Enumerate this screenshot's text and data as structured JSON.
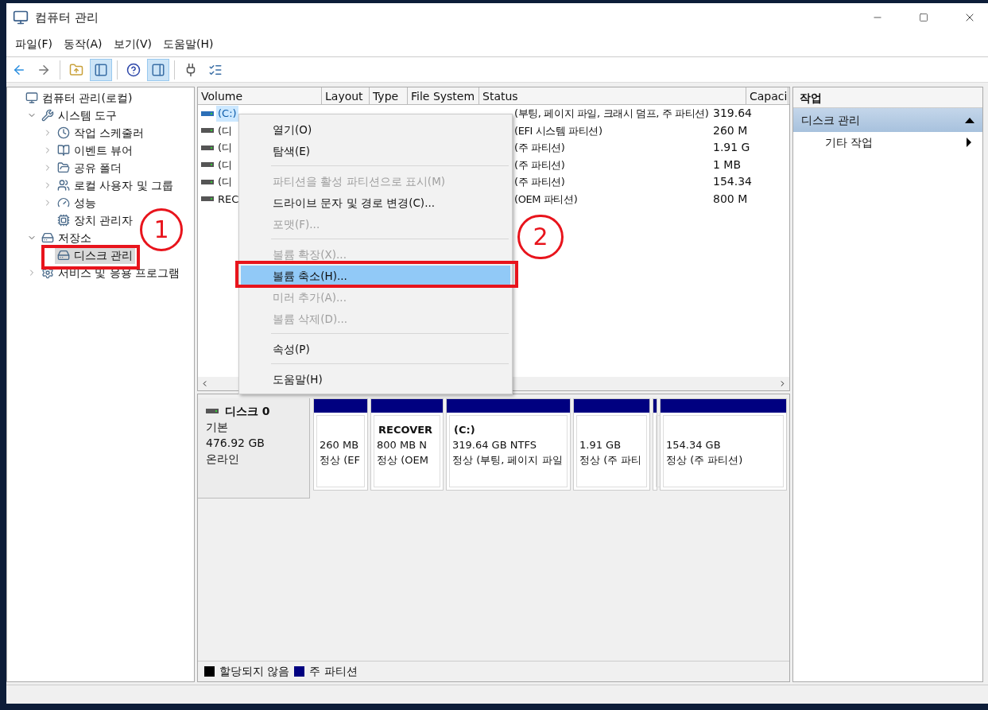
{
  "window": {
    "title": "컴퓨터 관리"
  },
  "menu_bar": [
    "파일(F)",
    "동작(A)",
    "보기(V)",
    "도움말(H)"
  ],
  "toolbar": [
    {
      "kind": "back",
      "pressed": false
    },
    {
      "kind": "forward",
      "pressed": false
    },
    {
      "kind": "up",
      "pressed": false
    },
    {
      "kind": "tree-pane",
      "pressed": true
    },
    {
      "kind": "help",
      "pressed": false
    },
    {
      "kind": "action-pane",
      "pressed": true
    },
    {
      "kind": "connect",
      "pressed": false
    },
    {
      "kind": "properties",
      "pressed": false
    }
  ],
  "tree": [
    {
      "label": "컴퓨터 관리(로컬)",
      "kind": "computer",
      "selected": false,
      "children": [
        {
          "label": "시스템 도구",
          "kind": "tools",
          "expanded": true,
          "selected": false,
          "children": [
            {
              "label": "작업 스케줄러",
              "kind": "clock",
              "expanded": false,
              "selected": false
            },
            {
              "label": "이벤트 뷰어",
              "kind": "log",
              "expanded": false,
              "selected": false
            },
            {
              "label": "공유 폴더",
              "kind": "share",
              "expanded": false,
              "selected": false
            },
            {
              "label": "로컬 사용자 및 그룹",
              "kind": "users",
              "expanded": false,
              "selected": false
            },
            {
              "label": "성능",
              "kind": "gauge",
              "expanded": false,
              "selected": false
            },
            {
              "label": "장치 관리자",
              "kind": "device",
              "selected": false
            }
          ]
        },
        {
          "label": "저장소",
          "kind": "storage",
          "expanded": true,
          "selected": false,
          "children": [
            {
              "label": "디스크 관리",
              "kind": "disk",
              "selected": true
            }
          ]
        },
        {
          "label": "서비스 및 응용 프로그램",
          "kind": "services",
          "expanded": false,
          "selected": false
        }
      ]
    }
  ],
  "volume_table": {
    "columns": [
      "Volume",
      "Layout",
      "Type",
      "File System",
      "Status",
      "Capaci"
    ],
    "rows": [
      {
        "volume": "(C:)",
        "status": "(부팅, 페이지 파일, 크래시 덤프, 주 파티션)",
        "capacity": "319.64",
        "selected": true
      },
      {
        "volume": "(디",
        "status": "(EFI 시스템 파티션)",
        "capacity": "260 M",
        "selected": false
      },
      {
        "volume": "(디",
        "status": "(주 파티션)",
        "capacity": "1.91 G",
        "selected": false
      },
      {
        "volume": "(디",
        "status": "(주 파티션)",
        "capacity": "1 MB",
        "selected": false
      },
      {
        "volume": "(디",
        "status": "(주 파티션)",
        "capacity": "154.34",
        "selected": false
      },
      {
        "volume": "REC",
        "status": "(OEM 파티션)",
        "capacity": "800 M",
        "selected": false
      }
    ]
  },
  "context_menu": [
    {
      "kind": "item",
      "label": "열기(O)",
      "disabled": false,
      "selected": false
    },
    {
      "kind": "item",
      "label": "탐색(E)",
      "disabled": false,
      "selected": false
    },
    {
      "kind": "separator"
    },
    {
      "kind": "item",
      "label": "파티션을 활성 파티션으로 표시(M)",
      "disabled": true,
      "selected": false
    },
    {
      "kind": "item",
      "label": "드라이브 문자 및 경로 변경(C)...",
      "disabled": false,
      "selected": false
    },
    {
      "kind": "item",
      "label": "포맷(F)...",
      "disabled": true,
      "selected": false
    },
    {
      "kind": "separator"
    },
    {
      "kind": "item",
      "label": "볼륨 확장(X)...",
      "disabled": true,
      "selected": false
    },
    {
      "kind": "item",
      "label": "볼륨 축소(H)...",
      "disabled": false,
      "selected": true
    },
    {
      "kind": "item",
      "label": "미러 추가(A)...",
      "disabled": true,
      "selected": false
    },
    {
      "kind": "item",
      "label": "볼륨 삭제(D)...",
      "disabled": true,
      "selected": false
    },
    {
      "kind": "separator"
    },
    {
      "kind": "item",
      "label": "속성(P)",
      "disabled": false,
      "selected": false
    },
    {
      "kind": "separator"
    },
    {
      "kind": "item",
      "label": "도움말(H)",
      "disabled": false,
      "selected": false
    }
  ],
  "disk": {
    "name": "디스크 0",
    "type": "기본",
    "size": "476.92 GB",
    "state": "온라인",
    "partitions": [
      {
        "kind": "partition",
        "size": "260 MB",
        "status": "정상 (EF"
      },
      {
        "kind": "partition",
        "name": "RECOVER",
        "size": "800 MB N",
        "status": "정상 (OEM"
      },
      {
        "kind": "partition",
        "name": "(C:)",
        "size": "319.64 GB NTFS",
        "status": "정상 (부팅, 페이지 파일"
      },
      {
        "kind": "partition",
        "size": "1.91 GB",
        "status": "정상 (주 파티"
      },
      {
        "kind": "partition"
      },
      {
        "kind": "partition",
        "size": "154.34 GB",
        "status": "정상 (주 파티션)"
      }
    ]
  },
  "legend": [
    {
      "label": "할당되지 않음",
      "color": "#000000"
    },
    {
      "label": "주 파티션",
      "color": "#000080"
    }
  ],
  "actions": {
    "header": "작업",
    "section": {
      "label": "디스크 관리",
      "expanded": true
    },
    "items": [
      {
        "label": "기타 작업"
      }
    ]
  },
  "annotations": [
    {
      "kind": "box"
    },
    {
      "kind": "box"
    },
    {
      "kind": "circle",
      "label": "1"
    },
    {
      "kind": "circle",
      "label": "2"
    }
  ]
}
